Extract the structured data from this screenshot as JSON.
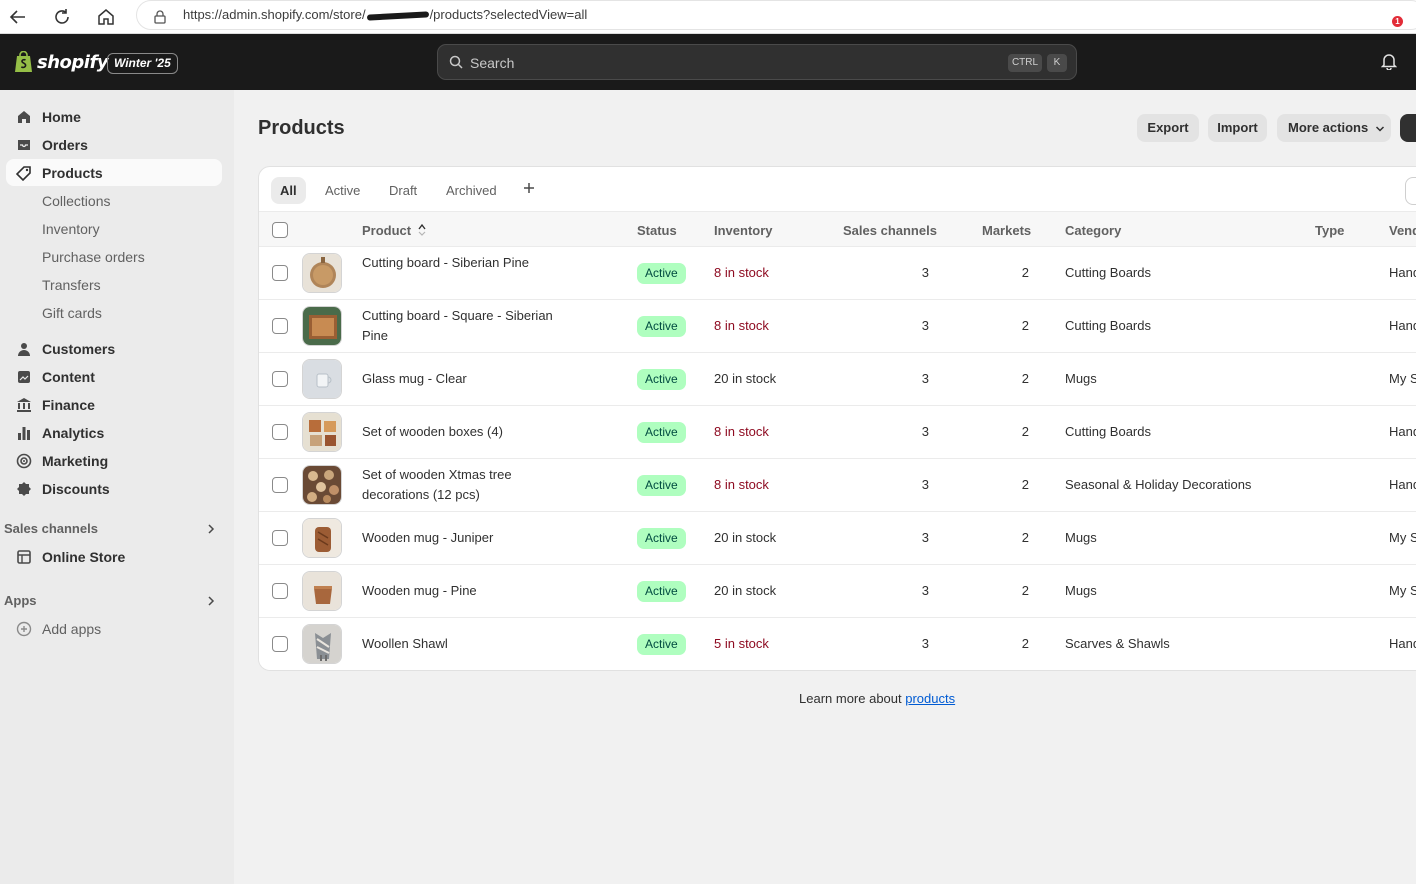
{
  "browser": {
    "url_prefix": "https://admin.shopify.com/store/",
    "url_suffix": "/products?selectedView=all"
  },
  "topbar": {
    "brand": "shopify",
    "edition": "Winter '25",
    "search_placeholder": "Search",
    "shortcut_ctrl": "CTRL",
    "shortcut_key": "K",
    "notification_count": "1"
  },
  "sidebar": {
    "items": [
      {
        "label": "Home",
        "icon": "home-icon"
      },
      {
        "label": "Orders",
        "icon": "orders-icon"
      },
      {
        "label": "Products",
        "icon": "tag-icon"
      }
    ],
    "product_subitems": [
      "Collections",
      "Inventory",
      "Purchase orders",
      "Transfers",
      "Gift cards"
    ],
    "items2": [
      {
        "label": "Customers",
        "icon": "person-icon"
      },
      {
        "label": "Content",
        "icon": "content-icon"
      },
      {
        "label": "Finance",
        "icon": "bank-icon"
      },
      {
        "label": "Analytics",
        "icon": "chart-icon"
      },
      {
        "label": "Marketing",
        "icon": "target-icon"
      },
      {
        "label": "Discounts",
        "icon": "discount-icon"
      }
    ],
    "sales_channels_title": "Sales channels",
    "online_store": "Online Store",
    "apps_title": "Apps",
    "add_apps": "Add apps"
  },
  "main": {
    "title": "Products",
    "export": "Export",
    "import": "Import",
    "more_actions": "More actions"
  },
  "tabs": [
    "All",
    "Active",
    "Draft",
    "Archived"
  ],
  "table": {
    "headers": {
      "product": "Product",
      "status": "Status",
      "inventory": "Inventory",
      "sales_channels": "Sales channels",
      "markets": "Markets",
      "category": "Category",
      "type": "Type",
      "vendor": "Vend"
    },
    "rows": [
      {
        "name": "Cutting board - Siberian Pine",
        "status": "Active",
        "inventory": "8 in stock",
        "low": true,
        "channels": "3",
        "markets": "2",
        "category": "Cutting Boards",
        "vendor": "Hand"
      },
      {
        "name": "Cutting board - Square - Siberian Pine",
        "status": "Active",
        "inventory": "8 in stock",
        "low": true,
        "channels": "3",
        "markets": "2",
        "category": "Cutting Boards",
        "vendor": "Hand"
      },
      {
        "name": "Glass mug - Clear",
        "status": "Active",
        "inventory": "20 in stock",
        "low": false,
        "channels": "3",
        "markets": "2",
        "category": "Mugs",
        "vendor": "My S"
      },
      {
        "name": "Set of wooden boxes (4)",
        "status": "Active",
        "inventory": "8 in stock",
        "low": true,
        "channels": "3",
        "markets": "2",
        "category": "Cutting Boards",
        "vendor": "Hand"
      },
      {
        "name": "Set of wooden Xtmas tree decorations (12 pcs)",
        "status": "Active",
        "inventory": "8 in stock",
        "low": true,
        "channels": "3",
        "markets": "2",
        "category": "Seasonal & Holiday Decorations",
        "vendor": "Hand"
      },
      {
        "name": "Wooden mug - Juniper",
        "status": "Active",
        "inventory": "20 in stock",
        "low": false,
        "channels": "3",
        "markets": "2",
        "category": "Mugs",
        "vendor": "My S"
      },
      {
        "name": "Wooden mug - Pine",
        "status": "Active",
        "inventory": "20 in stock",
        "low": false,
        "channels": "3",
        "markets": "2",
        "category": "Mugs",
        "vendor": "My S"
      },
      {
        "name": "Woollen Shawl",
        "status": "Active",
        "inventory": "5 in stock",
        "low": true,
        "channels": "3",
        "markets": "2",
        "category": "Scarves & Shawls",
        "vendor": "Hand"
      }
    ]
  },
  "footer": {
    "learn_text": "Learn more about",
    "learn_link": "products"
  },
  "colors": {
    "low_stock": "#8e0b21",
    "normal_stock": "#303030",
    "badge_bg": "#affebf",
    "link": "#005bd3"
  }
}
